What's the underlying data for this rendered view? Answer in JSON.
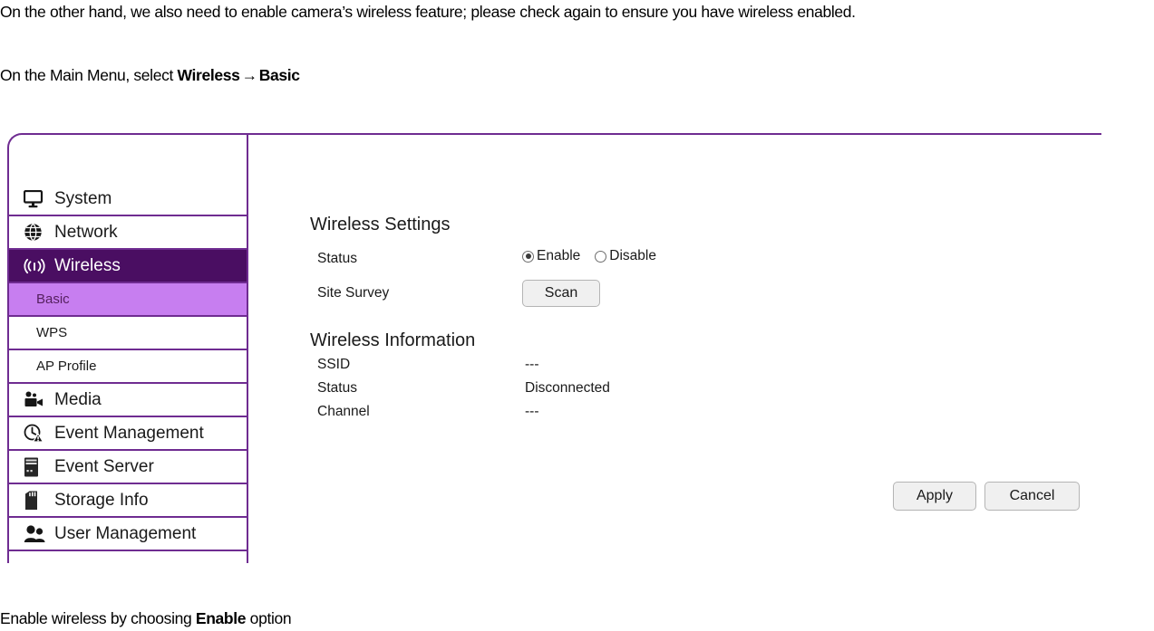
{
  "document": {
    "intro_paragraph": "On the other hand, we also need to enable camera’s wireless feature; please check again to ensure you have wireless enabled.",
    "menu_path": {
      "prefix": "On the Main Menu, select ",
      "first": "Wireless",
      "arrow": "→",
      "second": "Basic"
    },
    "closing": {
      "prefix": "Enable wireless by choosing ",
      "bold": "Enable",
      "suffix": " option"
    }
  },
  "colors": {
    "panel_border": "#6f2c91",
    "active_parent_bg": "#4a0e62",
    "active_parent_text": "#ffffff",
    "active_child_bg": "#c77ef0",
    "active_child_text": "#55205f",
    "button_bg": "#f0f0f0",
    "button_border": "#b4b4b4"
  },
  "sidebar": {
    "items": [
      {
        "label": "System",
        "icon": "monitor-icon",
        "level": "top",
        "state": "normal"
      },
      {
        "label": "Network",
        "icon": "globe-icon",
        "level": "top",
        "state": "normal"
      },
      {
        "label": "Wireless",
        "icon": "wireless-signal-icon",
        "level": "top",
        "state": "active-parent"
      },
      {
        "label": "Basic",
        "icon": "none",
        "level": "sub",
        "state": "active-child"
      },
      {
        "label": "WPS",
        "icon": "none",
        "level": "sub",
        "state": "normal"
      },
      {
        "label": "AP Profile",
        "icon": "none",
        "level": "sub",
        "state": "normal"
      },
      {
        "label": "Media",
        "icon": "video-camera-icon",
        "level": "top",
        "state": "normal"
      },
      {
        "label": "Event Management",
        "icon": "clock-alert-icon",
        "level": "top",
        "state": "normal"
      },
      {
        "label": "Event Server",
        "icon": "server-icon",
        "level": "top",
        "state": "normal"
      },
      {
        "label": "Storage Info",
        "icon": "sd-card-icon",
        "level": "top",
        "state": "normal"
      },
      {
        "label": "User Management",
        "icon": "users-icon",
        "level": "top",
        "state": "normal"
      }
    ]
  },
  "content": {
    "wireless_settings": {
      "title": "Wireless Settings",
      "status_label": "Status",
      "radio_options": [
        {
          "label": "Enable",
          "checked": true
        },
        {
          "label": "Disable",
          "checked": false
        }
      ],
      "site_survey_label": "Site Survey",
      "scan_button": "Scan"
    },
    "wireless_information": {
      "title": "Wireless Information",
      "rows": [
        {
          "label": "SSID",
          "value": "---"
        },
        {
          "label": "Status",
          "value": "Disconnected"
        },
        {
          "label": "Channel",
          "value": "---"
        }
      ]
    },
    "actions": {
      "apply": "Apply",
      "cancel": "Cancel"
    }
  }
}
